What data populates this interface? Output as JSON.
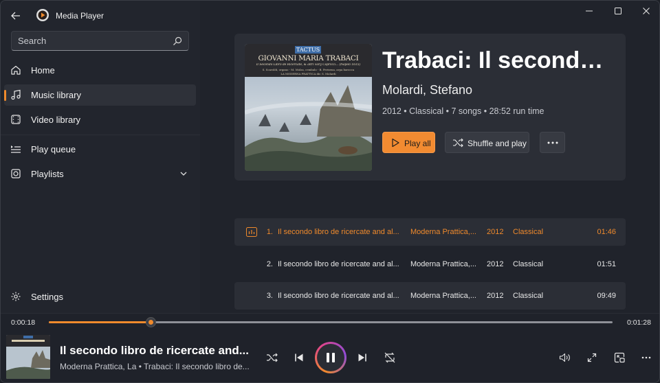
{
  "app": {
    "title": "Media Player"
  },
  "search": {
    "placeholder": "Search"
  },
  "nav": {
    "home": "Home",
    "music_library": "Music library",
    "video_library": "Video library",
    "play_queue": "Play queue",
    "playlists": "Playlists",
    "settings": "Settings"
  },
  "album": {
    "title": "Trabaci: Il secondo libro de ricercate and altri varij capricci",
    "title_display": "Trabaci: Il secondo…",
    "artist": "Molardi, Stefano",
    "meta": "2012 • Classical • 7 songs • 28:52 run time",
    "cover": {
      "label": "TACTUS",
      "composer": "GIOVANNI MARIA TRABACI",
      "subtitle": "Il Secondo Libro de Ricercate, & altri varij Capricci... (Napoli 1615)",
      "credits_1": "S. Scaroldi, organo - M. Molza, cembalo - B. Perisena, arpa barocca",
      "credits_2": "LA MODERNA PRATTICA dir. S. Molardi"
    }
  },
  "actions": {
    "play_all": "Play all",
    "shuffle_and_play": "Shuffle and play"
  },
  "tracks": [
    {
      "num": "1.",
      "title": "Il secondo libro de ricercate and al...",
      "artist": "Moderna Prattica,...",
      "year": "2012",
      "genre": "Classical",
      "duration": "01:46",
      "playing": true
    },
    {
      "num": "2.",
      "title": "Il secondo libro de ricercate and al...",
      "artist": "Moderna Prattica,...",
      "year": "2012",
      "genre": "Classical",
      "duration": "01:51",
      "playing": false
    },
    {
      "num": "3.",
      "title": "Il secondo libro de ricercate and al...",
      "artist": "Moderna Prattica,...",
      "year": "2012",
      "genre": "Classical",
      "duration": "09:49",
      "playing": false
    }
  ],
  "player": {
    "current_time": "0:00:18",
    "total_time": "0:01:28",
    "progress": 0.18,
    "title": "Il secondo libro de ricercate and...",
    "subtitle": "Moderna Prattica, La • Trabaci: Il secondo libro de..."
  },
  "colors": {
    "accent": "#f08a2c",
    "background": "#20232b",
    "card": "#2b2e36"
  }
}
